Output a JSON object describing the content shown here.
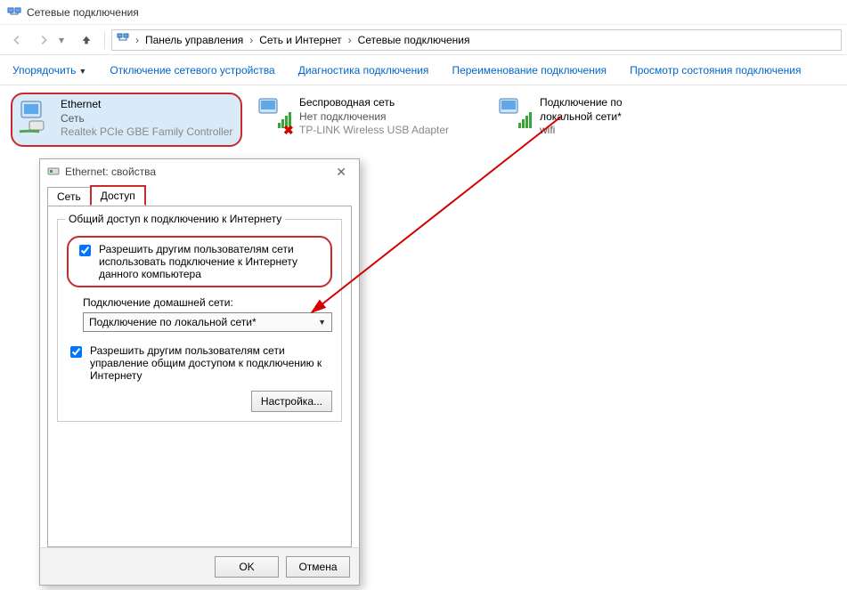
{
  "window": {
    "title": "Сетевые подключения"
  },
  "breadcrumbs": [
    "Панель управления",
    "Сеть и Интернет",
    "Сетевые подключения"
  ],
  "toolbar": {
    "organize": "Упорядочить",
    "disable": "Отключение сетевого устройства",
    "diagnose": "Диагностика подключения",
    "rename": "Переименование подключения",
    "status": "Просмотр состояния подключения"
  },
  "connections": [
    {
      "name": "Ethernet",
      "status": "Сеть",
      "device": "Realtek PCIe GBE Family Controller",
      "selected": true,
      "bad": false
    },
    {
      "name": "Беспроводная сеть",
      "status": "Нет подключения",
      "device": "TP-LINK Wireless USB Adapter",
      "selected": false,
      "bad": true
    },
    {
      "name": "Подключение по локальной сети*",
      "status": "wifi",
      "device": "",
      "selected": false,
      "bad": false
    }
  ],
  "dialog": {
    "title": "Ethernet: свойства",
    "tabs": {
      "network": "Сеть",
      "access": "Доступ"
    },
    "group_legend": "Общий доступ к подключению к Интернету",
    "chk1": "Разрешить другим пользователям сети использовать подключение к Интернету данного компьютера",
    "sub_label": "Подключение домашней сети:",
    "select_value": "Подключение по локальной сети*",
    "chk2": "Разрешить другим пользователям сети управление общим доступом к подключению к Интернету",
    "settings_btn": "Настройка...",
    "ok": "OK",
    "cancel": "Отмена"
  }
}
